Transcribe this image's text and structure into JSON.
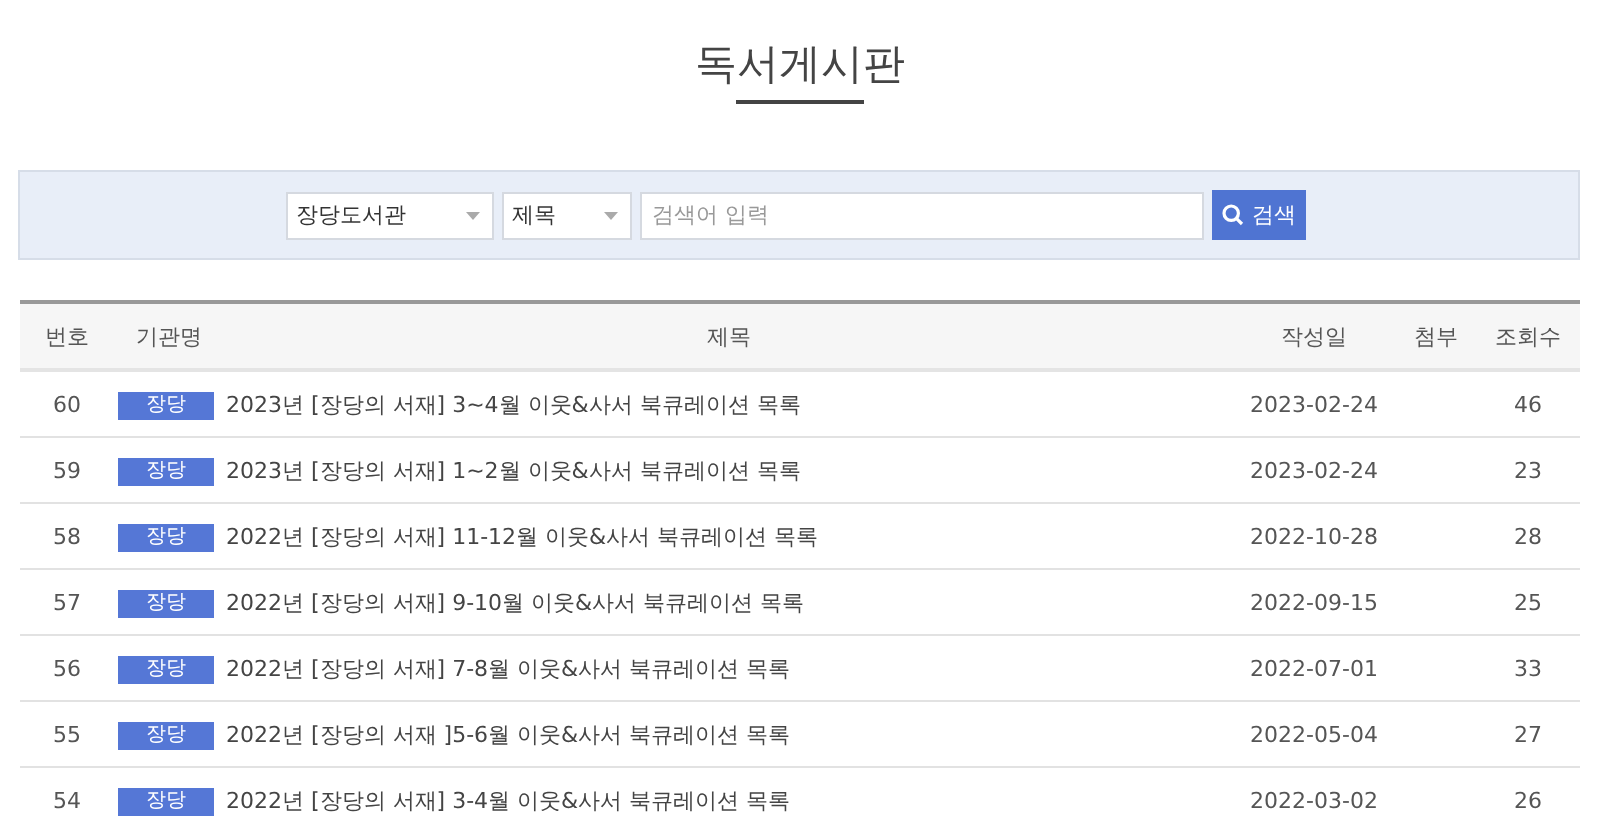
{
  "page_title": "독서게시판",
  "search": {
    "library": "장당도서관",
    "field": "제목",
    "placeholder": "검색어 입력",
    "button": "검색"
  },
  "table": {
    "columns": [
      "번호",
      "기관명",
      "제목",
      "작성일",
      "첨부",
      "조회수"
    ],
    "rows": [
      {
        "number": "60",
        "agency": "장당",
        "title": "2023년 [장당의 서재] 3~4월 이웃&사서 북큐레이션 목록",
        "date": "2023-02-24",
        "views": "46"
      },
      {
        "number": "59",
        "agency": "장당",
        "title": "2023년 [장당의 서재] 1~2월 이웃&사서 북큐레이션 목록",
        "date": "2023-02-24",
        "views": "23"
      },
      {
        "number": "58",
        "agency": "장당",
        "title": "2022년 [장당의 서재] 11-12월 이웃&사서 북큐레이션 목록",
        "date": "2022-10-28",
        "views": "28"
      },
      {
        "number": "57",
        "agency": "장당",
        "title": "2022년 [장당의 서재] 9-10월 이웃&사서 북큐레이션 목록",
        "date": "2022-09-15",
        "views": "25"
      },
      {
        "number": "56",
        "agency": "장당",
        "title": "2022년 [장당의 서재] 7-8월 이웃&사서 북큐레이션 목록",
        "date": "2022-07-01",
        "views": "33"
      },
      {
        "number": "55",
        "agency": "장당",
        "title": "2022년 [장당의 서재 ]5-6월 이웃&사서 북큐레이션 목록",
        "date": "2022-05-04",
        "views": "27"
      },
      {
        "number": "54",
        "agency": "장당",
        "title": "2022년 [장당의 서재] 3-4월 이웃&사서 북큐레이션 목록",
        "date": "2022-03-02",
        "views": "26"
      }
    ]
  }
}
